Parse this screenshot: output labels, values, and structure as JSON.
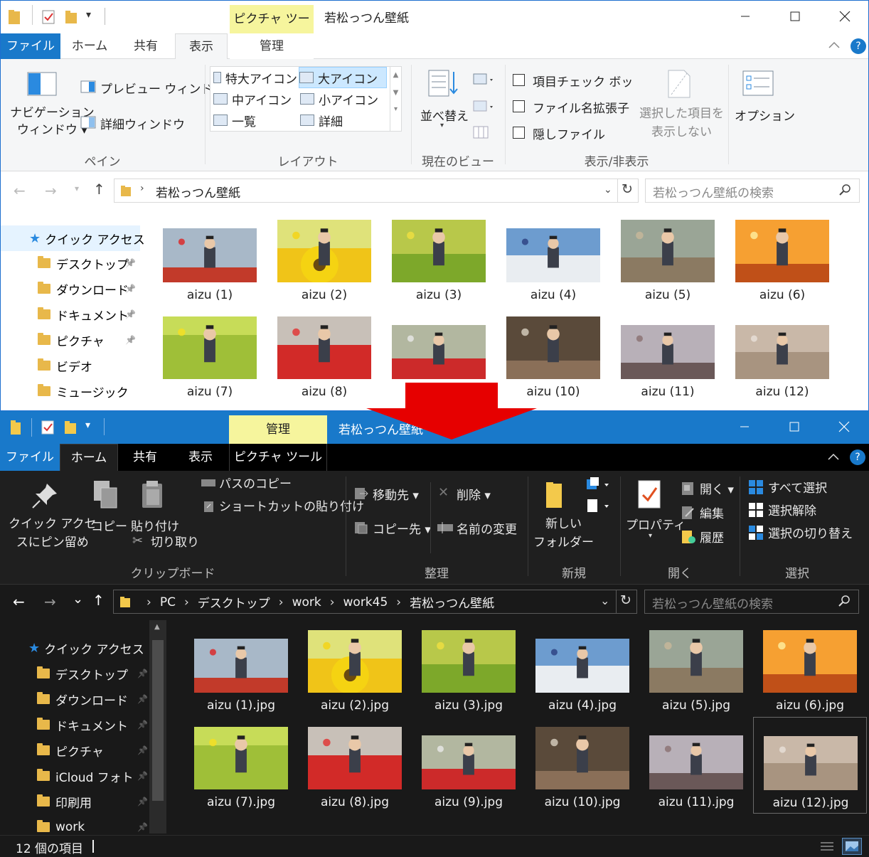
{
  "top": {
    "qat_dropdown": "▾",
    "context_tab_header": "ピクチャ ツール",
    "title": "若松っつん壁紙",
    "tabs": {
      "file": "ファイル",
      "home": "ホーム",
      "share": "共有",
      "view": "表示",
      "manage": "管理"
    },
    "ribbon": {
      "nav_pane": "ナビゲーション\nウィンドウ ▾",
      "preview_pane": "プレビュー ウィンドウ",
      "details_pane": "詳細ウィンドウ",
      "group_pane": "ペイン",
      "layout": {
        "extra_large": "特大アイコン",
        "large": "大アイコン",
        "medium": "中アイコン",
        "small": "小アイコン",
        "list": "一覧",
        "details": "詳細"
      },
      "group_layout": "レイアウト",
      "sort_by": "並べ替え",
      "group_current_view": "現在のビュー",
      "item_checkboxes": "項目チェック ボックス",
      "file_ext": "ファイル名拡張子",
      "hidden_items": "隠しファイル",
      "hide_selected": "選択した項目を\n表示しない",
      "group_show_hide": "表示/非表示",
      "options": "オプション"
    },
    "address": {
      "path": "若松っつん壁紙",
      "search_placeholder": "若松っつん壁紙の検索"
    },
    "nav": [
      "クイック アクセス",
      "デスクトップ",
      "ダウンロード",
      "ドキュメント",
      "ピクチャ",
      "ビデオ",
      "ミュージック"
    ],
    "files": [
      "aizu (1)",
      "aizu (2)",
      "aizu (3)",
      "aizu (4)",
      "aizu (5)",
      "aizu (6)",
      "aizu (7)",
      "aizu (8)",
      "aizu (9)",
      "aizu (10)",
      "aizu (11)",
      "aizu (12)"
    ]
  },
  "bottom": {
    "context_tab_header": "管理",
    "title": "若松っつん壁紙",
    "tabs": {
      "file": "ファイル",
      "home": "ホーム",
      "share": "共有",
      "view": "表示",
      "picture_tools": "ピクチャ ツール"
    },
    "ribbon": {
      "pin_quick_access": "クイック アクセ\nスにピン留め",
      "copy": "コピー",
      "paste": "貼り付け",
      "copy_path": "パスのコピー",
      "paste_shortcut": "ショートカットの貼り付け",
      "cut": "切り取り",
      "group_clipboard": "クリップボード",
      "move_to": "移動先 ▾",
      "copy_to": "コピー先 ▾",
      "delete": "削除 ▾",
      "rename": "名前の変更",
      "group_organize": "整理",
      "new_folder": "新しい\nフォルダー",
      "group_new": "新規",
      "properties": "プロパティ",
      "open": "開く ▾",
      "edit": "編集",
      "history": "履歴",
      "group_open": "開く",
      "select_all": "すべて選択",
      "select_none": "選択解除",
      "invert_selection": "選択の切り替え",
      "group_select": "選択"
    },
    "address": {
      "crumbs": [
        "PC",
        "デスクトップ",
        "work",
        "work45",
        "若松っつん壁紙"
      ],
      "search_placeholder": "若松っつん壁紙の検索"
    },
    "nav": [
      "クイック アクセス",
      "デスクトップ",
      "ダウンロード",
      "ドキュメント",
      "ピクチャ",
      "iCloud フォト",
      "印刷用",
      "work"
    ],
    "files": [
      "aizu (1).jpg",
      "aizu (2).jpg",
      "aizu (3).jpg",
      "aizu (4).jpg",
      "aizu (5).jpg",
      "aizu (6).jpg",
      "aizu (7).jpg",
      "aizu (8).jpg",
      "aizu (9).jpg",
      "aizu (10).jpg",
      "aizu (11).jpg",
      "aizu (12).jpg"
    ],
    "status": "12 個の項目"
  },
  "colors": {
    "accent": "#1979ca",
    "dark_bg": "#191919",
    "context_tab": "#f6f59d",
    "arrow": "#e60000"
  },
  "thumb_scenes": [
    "track",
    "sunflower",
    "meadow",
    "castle",
    "river",
    "fire",
    "dandelion",
    "redmat",
    "lawn",
    "window",
    "mountain",
    "crawl"
  ]
}
